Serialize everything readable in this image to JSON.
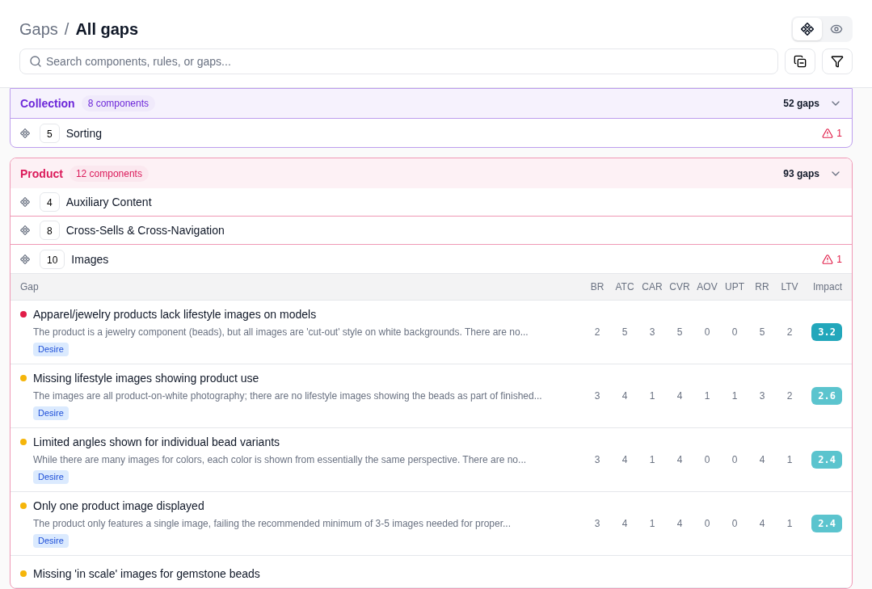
{
  "breadcrumb": {
    "parent": "Gaps",
    "separator": "/",
    "current": "All gaps"
  },
  "view_toggle": [
    {
      "kind": "components",
      "selected": true
    },
    {
      "kind": "preview",
      "selected": false
    }
  ],
  "search": {
    "placeholder": "Search components, rules, or gaps..."
  },
  "sections": [
    {
      "name": "Collection",
      "color": "#6d28d9",
      "badge": "8 components",
      "gaps": "52 gaps",
      "components": [
        {
          "count": "5",
          "name": "Sorting",
          "alerts": "1"
        }
      ]
    },
    {
      "name": "Product",
      "color": "#db1a5a",
      "badge": "12 components",
      "gaps": "93 gaps",
      "components": [
        {
          "count": "4",
          "name": "Auxiliary Content"
        },
        {
          "count": "8",
          "name": "Cross-Sells & Cross-Navigation"
        },
        {
          "count": "10",
          "name": "Images",
          "alerts": "1",
          "table": {
            "columns": [
              "Gap",
              "BR",
              "ATC",
              "CAR",
              "CVR",
              "AOV",
              "UPT",
              "RR",
              "LTV",
              "Impact"
            ],
            "rows": [
              {
                "color": "#e11d48",
                "title": "Apparel/jewelry products lack lifestyle images on models",
                "description": "The product is a jewelry component (beads), but all images are 'cut-out' style on white backgrounds. There are no...",
                "tag": "Desire",
                "scores": [
                  "2",
                  "5",
                  "3",
                  "5",
                  "0",
                  "0",
                  "5",
                  "2"
                ],
                "impact": {
                  "value": "3.2",
                  "color": "#22a7bb"
                }
              },
              {
                "color": "#f5b50a",
                "title": "Missing lifestyle images showing product use",
                "description": "The images are all product-on-white photography; there are no lifestyle images showing the beads as part of finished...",
                "tag": "Desire",
                "scores": [
                  "3",
                  "4",
                  "1",
                  "4",
                  "1",
                  "1",
                  "3",
                  "2"
                ],
                "impact": {
                  "value": "2.6",
                  "color": "#5bc4ce"
                }
              },
              {
                "color": "#f5b50a",
                "title": "Limited angles shown for individual bead variants",
                "description": "While there are many images for colors, each color is shown from essentially the same perspective. There are no...",
                "tag": "Desire",
                "scores": [
                  "3",
                  "4",
                  "1",
                  "4",
                  "0",
                  "0",
                  "4",
                  "1"
                ],
                "impact": {
                  "value": "2.4",
                  "color": "#5bc4ce"
                }
              },
              {
                "color": "#f5b50a",
                "title": "Only one product image displayed",
                "description": "The product only features a single image, failing the recommended minimum of 3-5 images needed for proper...",
                "tag": "Desire",
                "scores": [
                  "3",
                  "4",
                  "1",
                  "4",
                  "0",
                  "0",
                  "4",
                  "1"
                ],
                "impact": {
                  "value": "2.4",
                  "color": "#5bc4ce"
                }
              },
              {
                "color": "#f5b50a",
                "title": "Missing 'in scale' images for gemstone beads"
              }
            ]
          }
        }
      ]
    }
  ]
}
